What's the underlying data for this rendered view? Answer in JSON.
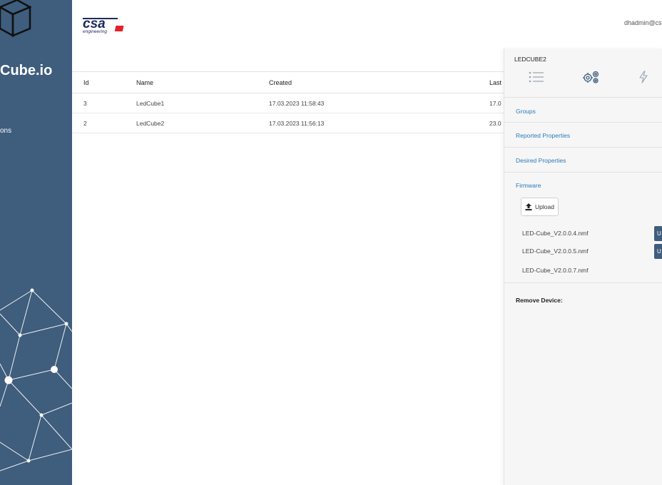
{
  "sidebar": {
    "brand": "Cube.io",
    "nav_item": "ons"
  },
  "header": {
    "logo_text": "csa",
    "logo_subtext": "engineering",
    "user": "dhadmin@cs"
  },
  "table": {
    "headers": [
      "Id",
      "Name",
      "Created",
      "Last"
    ],
    "rows": [
      {
        "id": "3",
        "name": "LedCube1",
        "created": "17.03.2023 11:58:43",
        "last": "17.0"
      },
      {
        "id": "2",
        "name": "LedCube2",
        "created": "17.03.2023 11:56:13",
        "last": "23.0"
      }
    ]
  },
  "panel": {
    "title": "LEDCUBE2",
    "tabs": [
      "list-icon",
      "settings-icon",
      "power-icon"
    ],
    "sections": {
      "groups": "Groups",
      "reported": "Reported Properties",
      "desired": "Desired Properties",
      "firmware": "Firmware"
    },
    "upload_label": "Upload",
    "firmware_files": [
      {
        "name": "LED-Cube_V2.0.0.4.nmf",
        "action": "U"
      },
      {
        "name": "LED-Cube_V2.0.0.5.nmf",
        "action": "U"
      },
      {
        "name": "LED-Cube_V2.0.0.7.nmf",
        "action": ""
      }
    ],
    "remove_label": "Remove Device:"
  },
  "colors": {
    "sidebar": "#3f5d7d",
    "link": "#2a7ab8",
    "logo_red": "#e4202a",
    "logo_navy": "#1d2a5c"
  }
}
